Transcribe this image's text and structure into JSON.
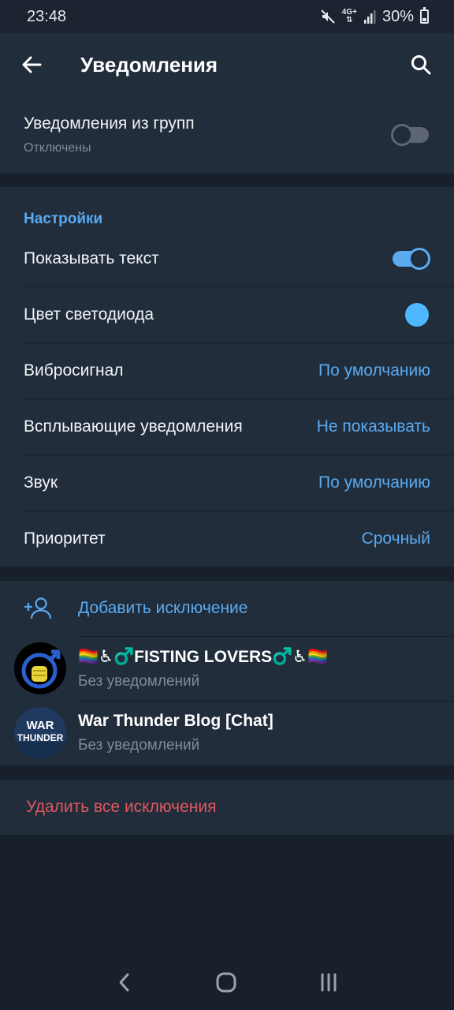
{
  "status_bar": {
    "time": "23:48",
    "network": "4G+",
    "battery": "30%",
    "battery_level": 0.3
  },
  "app_bar": {
    "title": "Уведомления"
  },
  "group_notifications": {
    "label": "Уведомления из групп",
    "sub": "Отключены",
    "enabled": false
  },
  "settings": {
    "header": "Настройки",
    "show_text": {
      "label": "Показывать текст",
      "enabled": true
    },
    "led_color": {
      "label": "Цвет светодиода",
      "color": "#4db8ff"
    },
    "vibrate": {
      "label": "Вибросигнал",
      "value": "По умолчанию"
    },
    "popup": {
      "label": "Всплывающие уведомления",
      "value": "Не показывать"
    },
    "sound": {
      "label": "Звук",
      "value": "По умолчанию"
    },
    "priority": {
      "label": "Приоритет",
      "value": "Срочный"
    }
  },
  "exceptions": {
    "add_label": "Добавить исключение",
    "items": [
      {
        "name": "🏳️‍🌈♿♂️FISTING LOVERS♂️♿🏳️‍🌈",
        "sub": "Без уведомлений"
      },
      {
        "name": "War Thunder Blog [Chat]",
        "sub": "Без уведомлений",
        "avatar_text_1": "WAR",
        "avatar_text_2": "THUNDER"
      }
    ]
  },
  "delete_all": {
    "label": "Удалить все исключения"
  },
  "colors": {
    "accent": "#5aaaf0",
    "danger": "#e0575f",
    "background": "#18202b",
    "surface": "#212d3b"
  }
}
